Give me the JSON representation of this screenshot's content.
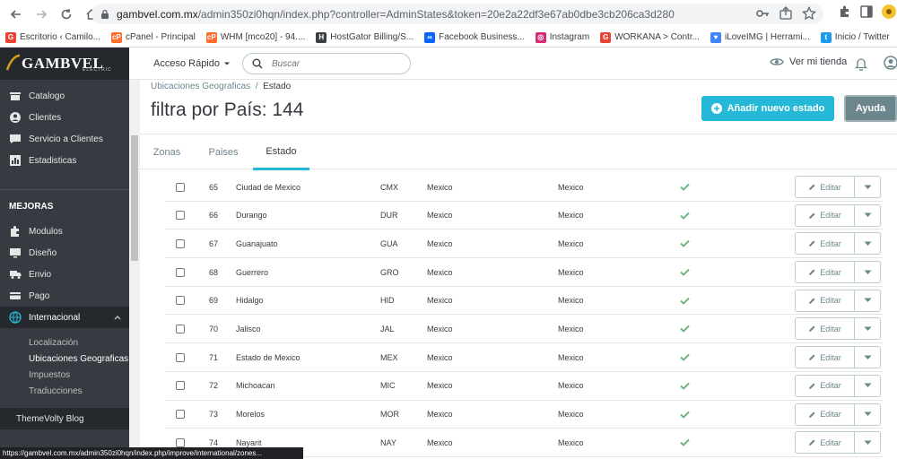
{
  "browser": {
    "url_host": "gambvel.com.mx",
    "url_path": "/admin350zi0hqn/index.php?controller=AdminStates&token=20e2a22df3e67ab0dbe3cb206ca3d280",
    "bookmarks": [
      {
        "label": "Escritorio ‹ Camilo...",
        "color": "#ea4335",
        "glyph": "G"
      },
      {
        "label": "cPanel - Principal",
        "color": "#ff6c2c",
        "glyph": "cP"
      },
      {
        "label": "WHM [mco20] - 94....",
        "color": "#ff6c2c",
        "glyph": "cP"
      },
      {
        "label": "HostGator Billing/S...",
        "color": "#3c4043",
        "glyph": "H"
      },
      {
        "label": "Facebook Business...",
        "color": "#0866ff",
        "glyph": "∞"
      },
      {
        "label": "Instagram",
        "color": "#d62976",
        "glyph": "◎"
      },
      {
        "label": "WORKANA > Contr...",
        "color": "#ea4335",
        "glyph": "G"
      },
      {
        "label": "iLoveIMG | Herrami...",
        "color": "#4285f4",
        "glyph": "♥"
      },
      {
        "label": "Inicio / Twitter",
        "color": "#1d9bf0",
        "glyph": "t"
      }
    ],
    "status_url": "https://gambvel.com.mx/admin350zi0hqn/index.php/improve/international/zones..."
  },
  "header": {
    "logo": "GAMBVEL",
    "logo_sub": "ELECTRIC",
    "quick_access": "Acceso Rápido",
    "search_placeholder": "Buscar",
    "view_shop": "Ver mi tienda"
  },
  "sidebar": {
    "items": [
      {
        "label": "Catalogo",
        "icon": "store-icon",
        "name": "sidebar-item-catalogo"
      },
      {
        "label": "Clientes",
        "icon": "user-circle-icon",
        "name": "sidebar-item-clientes"
      },
      {
        "label": "Servicio a Clientes",
        "icon": "chat-icon",
        "name": "sidebar-item-servicio-clientes"
      },
      {
        "label": "Estadisticas",
        "icon": "chart-icon",
        "name": "sidebar-item-estadisticas"
      }
    ],
    "section_title": "MEJORAS",
    "section_items": [
      {
        "label": "Modulos",
        "icon": "puzzle-icon",
        "name": "sidebar-item-modulos"
      },
      {
        "label": "Diseño",
        "icon": "monitor-icon",
        "name": "sidebar-item-diseno"
      },
      {
        "label": "Envio",
        "icon": "truck-icon",
        "name": "sidebar-item-envio"
      },
      {
        "label": "Pago",
        "icon": "card-icon",
        "name": "sidebar-item-pago"
      },
      {
        "label": "Internacional",
        "icon": "globe-icon",
        "name": "sidebar-item-internacional"
      }
    ],
    "sub_items": [
      "Localización",
      "Ubicaciones Geograficas",
      "Impuestos",
      "Traducciones"
    ],
    "theme_blog": "ThemeVolty Blog"
  },
  "main": {
    "breadcrumb_parent": "Ubicaciones Geograficas",
    "breadcrumb_sep": "/",
    "breadcrumb_current": "Estado",
    "title": "filtra por País: 144",
    "add_button": "Añadir nuevo estado",
    "help_button": "Ayuda",
    "tabs": [
      "Zonas",
      "Paises",
      "Estado"
    ],
    "edit_label": "Editar",
    "rows": [
      {
        "id": "65",
        "name": "Ciudad de Mexico",
        "iso": "CMX",
        "zone": "Mexico",
        "country": "Mexico"
      },
      {
        "id": "66",
        "name": "Durango",
        "iso": "DUR",
        "zone": "Mexico",
        "country": "Mexico"
      },
      {
        "id": "67",
        "name": "Guanajuato",
        "iso": "GUA",
        "zone": "Mexico",
        "country": "Mexico"
      },
      {
        "id": "68",
        "name": "Guerrero",
        "iso": "GRO",
        "zone": "Mexico",
        "country": "Mexico"
      },
      {
        "id": "69",
        "name": "Hidalgo",
        "iso": "HID",
        "zone": "Mexico",
        "country": "Mexico"
      },
      {
        "id": "70",
        "name": "Jalisco",
        "iso": "JAL",
        "zone": "Mexico",
        "country": "Mexico"
      },
      {
        "id": "71",
        "name": "Estado de Mexico",
        "iso": "MEX",
        "zone": "Mexico",
        "country": "Mexico"
      },
      {
        "id": "72",
        "name": "Michoacan",
        "iso": "MIC",
        "zone": "Mexico",
        "country": "Mexico"
      },
      {
        "id": "73",
        "name": "Morelos",
        "iso": "MOR",
        "zone": "Mexico",
        "country": "Mexico"
      },
      {
        "id": "74",
        "name": "Nayarit",
        "iso": "NAY",
        "zone": "Mexico",
        "country": "Mexico"
      }
    ]
  },
  "colors": {
    "accent": "#25b9d7",
    "sidebar": "#363a41",
    "check": "#70b580"
  }
}
